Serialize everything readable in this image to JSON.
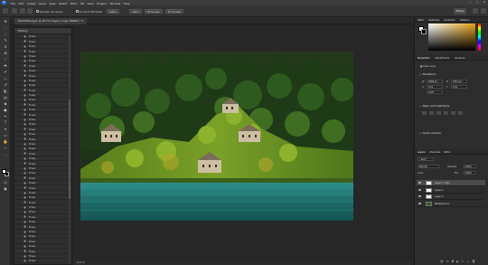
{
  "app": {
    "logo": "Ps",
    "menus": [
      "File",
      "Edit",
      "Image",
      "Layer",
      "Type",
      "Select",
      "Filter",
      "3D",
      "View",
      "Plugins",
      "Window",
      "Help"
    ],
    "window_controls": [
      "—",
      "▢",
      "✕"
    ]
  },
  "options_bar": {
    "sample_label": "Sample: All Layers",
    "scroll_all_label": "Scroll All Windows",
    "zoom_value": "100%",
    "fit_label": "Fit Screen",
    "fill_label": "Fill Screen",
    "share_label": "Share"
  },
  "document": {
    "tab_title": "DSC3499-Layer @ 16.7% (Layer 1 copy, RGB/8) *"
  },
  "history_panel": {
    "title": "History",
    "rows": [
      "Erase",
      "Erase",
      "Erase",
      "Erase",
      "Erase",
      "Erase",
      "Erase",
      "Erase",
      "Erase",
      "Erase",
      "Erase",
      "Erase",
      "Erase",
      "Erase",
      "Erase",
      "Erase",
      "Erase",
      "Erase",
      "Erase",
      "Erase",
      "Erase",
      "Erase",
      "Erase",
      "Erase",
      "Erase",
      "Erase",
      "Erase",
      "Erase",
      "Erase",
      "Erase",
      "Erase",
      "Erase",
      "Erase",
      "Erase",
      "Erase",
      "Erase",
      "Erase",
      "Erase",
      "Erase",
      "Erase",
      "Erase",
      "Erase",
      "Erase",
      "Erase",
      "Erase",
      "Erase",
      "Erase"
    ]
  },
  "right_panels": {
    "color_tabs": [
      "Color",
      "Swatches",
      "Gradients",
      "Patterns"
    ],
    "props_tabs": [
      "Properties",
      "Adjustments",
      "Libraries"
    ],
    "pixel_layer_label": "Pixel Layer",
    "transform_title": "Transform",
    "w_label": "W",
    "w_value": "5568 px",
    "h_label": "H",
    "h_value": "3712 px",
    "x_label": "X",
    "x_value": "0 px",
    "y_label": "Y",
    "y_value": "0 px",
    "angle_value": "0.00°",
    "align_title": "Align and Distribute",
    "quick_title": "Quick Actions",
    "layers_tabs": [
      "Layers",
      "Channels",
      "Paths"
    ],
    "kind_label": "Kind",
    "blend_mode": "Normal",
    "opacity_label": "Opacity:",
    "opacity_value": "100%",
    "lock_label": "Lock:",
    "fill_label": "Fill:",
    "fill_value": "100%",
    "layers": [
      {
        "name": "Layer 1 copy",
        "selected": true,
        "thumb": "#ffffff"
      },
      {
        "name": "Layer 1",
        "selected": false,
        "thumb": "#ffffff"
      },
      {
        "name": "Layer 2",
        "selected": false,
        "thumb": "#ffffff"
      },
      {
        "name": "Background",
        "selected": false,
        "thumb": "#3a5a22"
      }
    ]
  },
  "status": {
    "zoom": "16.67%"
  },
  "colors": {
    "foreground": "#ffffff",
    "background": "#000000",
    "accent": "#1f6fd6"
  }
}
